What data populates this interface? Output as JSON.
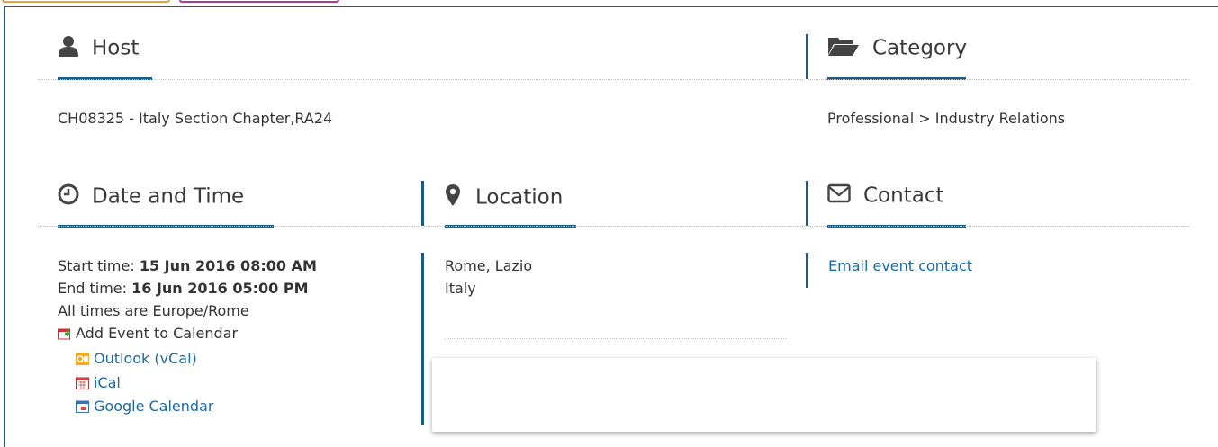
{
  "host": {
    "heading": "Host",
    "icon": "user-icon",
    "value": "CH08325 - Italy Section Chapter,RA24"
  },
  "category": {
    "heading": "Category",
    "icon": "folder-open-icon",
    "value": "Professional > Industry Relations"
  },
  "datetime": {
    "heading": "Date and Time",
    "icon": "clock-icon",
    "start_label": "Start time:",
    "start_value": "15 Jun 2016 08:00 AM",
    "end_label": "End time:",
    "end_value": "16 Jun 2016 05:00 PM",
    "timezone_note": "All times are Europe/Rome",
    "add_calendar": "Add Event to Calendar",
    "calendar_links": [
      "Outlook (vCal)",
      "iCal",
      "Google Calendar"
    ]
  },
  "location": {
    "heading": "Location",
    "icon": "map-marker-icon",
    "line1": "Rome, Lazio",
    "line2": "Italy"
  },
  "contact": {
    "heading": "Contact",
    "icon": "envelope-icon",
    "link": "Email event contact"
  },
  "colors": {
    "accent": "#1b5b87",
    "link": "#1b6aa5",
    "text": "#333333"
  }
}
